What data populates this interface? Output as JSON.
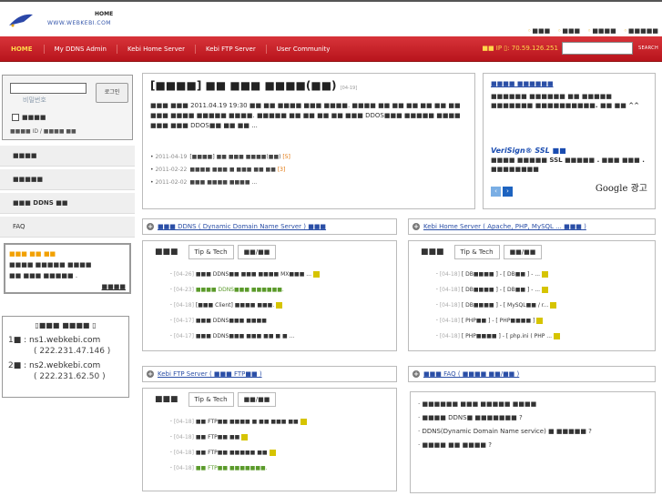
{
  "header": {
    "home_label": "HOME",
    "site_url": "WWW.WEBKEBI.COM",
    "top_links": [
      "■■■",
      "■■■",
      "■■■■",
      "■■■■■"
    ]
  },
  "nav": {
    "items": [
      "HOME",
      "My DDNS Admin",
      "Kebi Home Server",
      "Kebi FTP Server",
      "User Community"
    ],
    "ip_label": "■■ IP ▯: 70.59.126.251",
    "search_label": "SEARCH"
  },
  "login": {
    "password_placeholder": "비밀번호",
    "login_button": "로그인",
    "remember": "■■■■",
    "id_find": "■■■■ ID / ■■■■ ■■"
  },
  "sidebar": {
    "items": [
      "■■■■",
      "■■■■■",
      "■■■ DDNS ■■",
      "FAQ"
    ]
  },
  "promo": {
    "l1": "■■■ ■■ ■■",
    "l2": "■■■■ ■■■■■ ■■■■",
    "l3": "■■ ■■■ ■■■■■ .",
    "l4": "■■■■"
  },
  "dns": {
    "title": "▯■■■ ■■■■ ▯",
    "ns1_prefix": "1■ : ns1.webkebi.com",
    "ns1_ip": "( 222.231.47.146 )",
    "ns2_prefix": "2■ : ns2.webkebi.com",
    "ns2_ip": "( 222.231.62.50 )"
  },
  "main": {
    "title": "[■■■■] ■■ ■■■ ■■■■(■■)",
    "title_date": "[04-19]",
    "body": "■■■ ■■■ 2011.04.19 19:30 ■■ ■■ ■■■■ ■■■ ■■■■. ■■■■ ■■ ■■ ■■ ■■ ■■ ■■ ■■■ ■■■■ ■■■■■ ■■■■. ■■■■■ ■■ ■■ ■■ ■■ ■■■ DDOS■■■ ■■■■■ ■■■■ ■■■ ■■■ DDOS■■ ■■ ■■ ...",
    "news": [
      {
        "date": "2011-04-19",
        "text": "[■■■■] ■■ ■■■ ■■■■(■■)",
        "count": "[5]"
      },
      {
        "date": "2011-02-22",
        "text": "■■■■ ■■■ ■ ■■■ ■■ ■■",
        "count": "[3]"
      },
      {
        "date": "2011-02-02",
        "text": "■■■ ■■■■ ■■■■ ...",
        "count": ""
      }
    ]
  },
  "ad": {
    "headline": "■■■■ ■■■■■■",
    "body": "■■■■■■ ■■■■■■ ■■ ■■■■■ ■■■■■■■ ■■■■■■■■■■. ■■ ■■ ^^",
    "verisign": "VeriSign® SSL ■■",
    "verisign_body": "■■■■ ■■■■■ SSL ■■■■■ . ■■■ ■■■ . ■■■■■■■■",
    "google": "Google 광고"
  },
  "sections": {
    "ddns": {
      "title": "■■■ DDNS ( Dynamic Domain Name Server ) ■■■",
      "tabs": [
        "■■■",
        "Tip & Tech",
        "■■/■■"
      ],
      "rows": [
        {
          "date": "[04-26]",
          "text": "■■■ DDNS■■ ■■■ ■■■■ MX■■■ ..."
        },
        {
          "date": "[04-23]",
          "text": "■■■■ DDNS■■■ ■■■■■■."
        },
        {
          "date": "[04-18]",
          "text": "[■■■ Client] ■■■■ ■■■."
        },
        {
          "date": "[04-17]",
          "text": "■■■ DDNS■■■ ■■■■"
        },
        {
          "date": "[04-17]",
          "text": "■■■ DDNS■■■ ■■■ ■■ ■ ■ ..."
        }
      ]
    },
    "home": {
      "title": "Kebi Home Server ( Apache, PHP, MySQL ... ■■■ )",
      "tabs": [
        "■■■",
        "Tip & Tech",
        "■■/■■"
      ],
      "rows": [
        {
          "date": "[04-18]",
          "text": "[ DB■■■■ ] - [ DB■■ ] - ..."
        },
        {
          "date": "[04-18]",
          "text": "[ DB■■■■ ] - [ DB■■ ] - ..."
        },
        {
          "date": "[04-18]",
          "text": "[ DB■■■■ ] - [ MySQL■■ / r..."
        },
        {
          "date": "[04-18]",
          "text": "[ PHP■■ ] - [ PHP■■■■ ]"
        },
        {
          "date": "[04-18]",
          "text": "[ PHP■■■■ ] - [ php.ini ( PHP ..."
        }
      ]
    },
    "ftp": {
      "title": "Kebi FTP Server ( ■■■ FTP■■ )",
      "tabs": [
        "■■■",
        "Tip & Tech",
        "■■/■■"
      ],
      "rows": [
        {
          "date": "[04-18]",
          "text": "■■ FTP■■ ■■■■ ■ ■■ ■■■ ■■"
        },
        {
          "date": "[04-18]",
          "text": "■■ FTP■■ ■■"
        },
        {
          "date": "[04-18]",
          "text": "■■ FTP■■ ■■■■■ ■■"
        },
        {
          "date": "[04-18]",
          "text": "■■ FTP■■ ■■■■■■■."
        }
      ]
    },
    "faq": {
      "title": "■■■ FAQ ( ■■■■ ■■/■■ )",
      "rows": [
        "■■■■■■ ■■■ ■■■■■ ■■■■",
        "■■■■ DDNS■ ■■■■■■■ ?",
        "DDNS(Dynamic Domain Name service) ■ ■■■■■ ?",
        "■■■■ ■■ ■■■■ ?"
      ]
    }
  }
}
